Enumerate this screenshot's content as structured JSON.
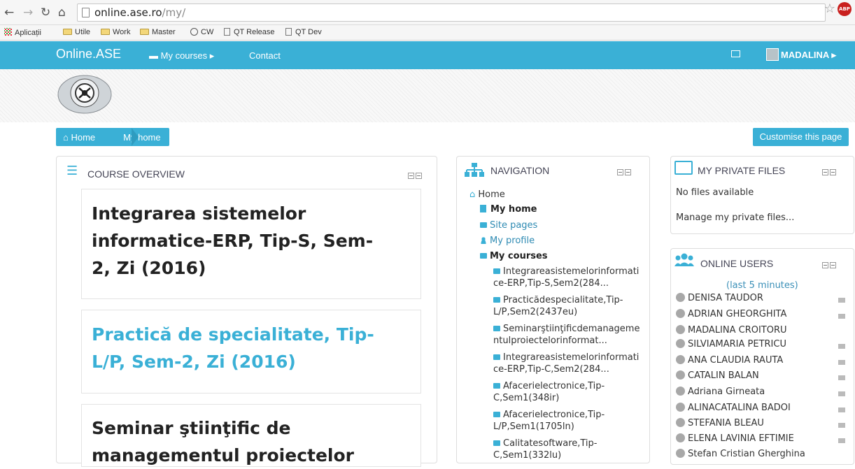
{
  "browser": {
    "url_host": "online.ase.ro",
    "url_path": "/my/",
    "bookmarks": [
      "Aplicații",
      "Utile",
      "Work",
      "Master",
      "CW",
      "QT Release",
      "QT Dev"
    ]
  },
  "navbar": {
    "brand": "Online.ASE",
    "my_courses": "My courses",
    "contact": "Contact",
    "user": "MADALINA"
  },
  "breadcrumb": {
    "home": "Home",
    "current": "My home"
  },
  "customise": "Customise this page",
  "course_overview": {
    "title": "COURSE OVERVIEW",
    "courses": [
      {
        "line1": "Integrarea sistemelor",
        "line2": "informatice-ERP, Tip-S, Sem-",
        "line3": "2, Zi (2016)"
      },
      {
        "line1": "Practică de specialitate, Tip-",
        "line2": "L/P, Sem-2, Zi (2016)"
      },
      {
        "line1": "Seminar ştiinţific de",
        "line2": "managementul proiectelor"
      }
    ]
  },
  "navigation": {
    "title": "NAVIGATION",
    "home": "Home",
    "my_home": "My home",
    "site_pages": "Site pages",
    "my_profile": "My profile",
    "my_courses": "My courses",
    "course_links": [
      [
        "Integrareasistemelorinformati",
        "ce-ERP,Tip-S,Sem2(284..."
      ],
      [
        "Practicădespecialitate,Tip-",
        "L/P,Sem2(2437eu)"
      ],
      [
        "Seminarştiinţificdemanageme",
        "ntulproiectelorinformat..."
      ],
      [
        "Integrareasistemelorinformati",
        "ce-ERP,Tip-C,Sem2(284..."
      ],
      [
        "Afacerielectronice,Tip-",
        "C,Sem1(348ir)"
      ],
      [
        "Afacerielectronice,Tip-",
        "L/P,Sem1(1705ln)"
      ],
      [
        "Calitatesoftware,Tip-",
        "C,Sem1(332lu)"
      ]
    ]
  },
  "private_files": {
    "title": "MY PRIVATE FILES",
    "empty": "No files available",
    "manage": "Manage my private files..."
  },
  "online_users": {
    "title": "ONLINE USERS",
    "subtitle": "(last 5 minutes)",
    "users": [
      "DENISA TAUDOR",
      "ADRIAN GHEORGHITA",
      "MADALINA CROITORU",
      "SILVIAMARIA PETRICU",
      "ANA CLAUDIA RAUTA",
      "CATALIN BALAN",
      "Adriana Girneata",
      "ALINACATALINA BADOI",
      "STEFANIA BLEAU",
      "ELENA LAVINIA EFTIMIE",
      "Stefan Cristian Gherghina"
    ]
  },
  "colors": {
    "accent": "#3ab0d6"
  }
}
